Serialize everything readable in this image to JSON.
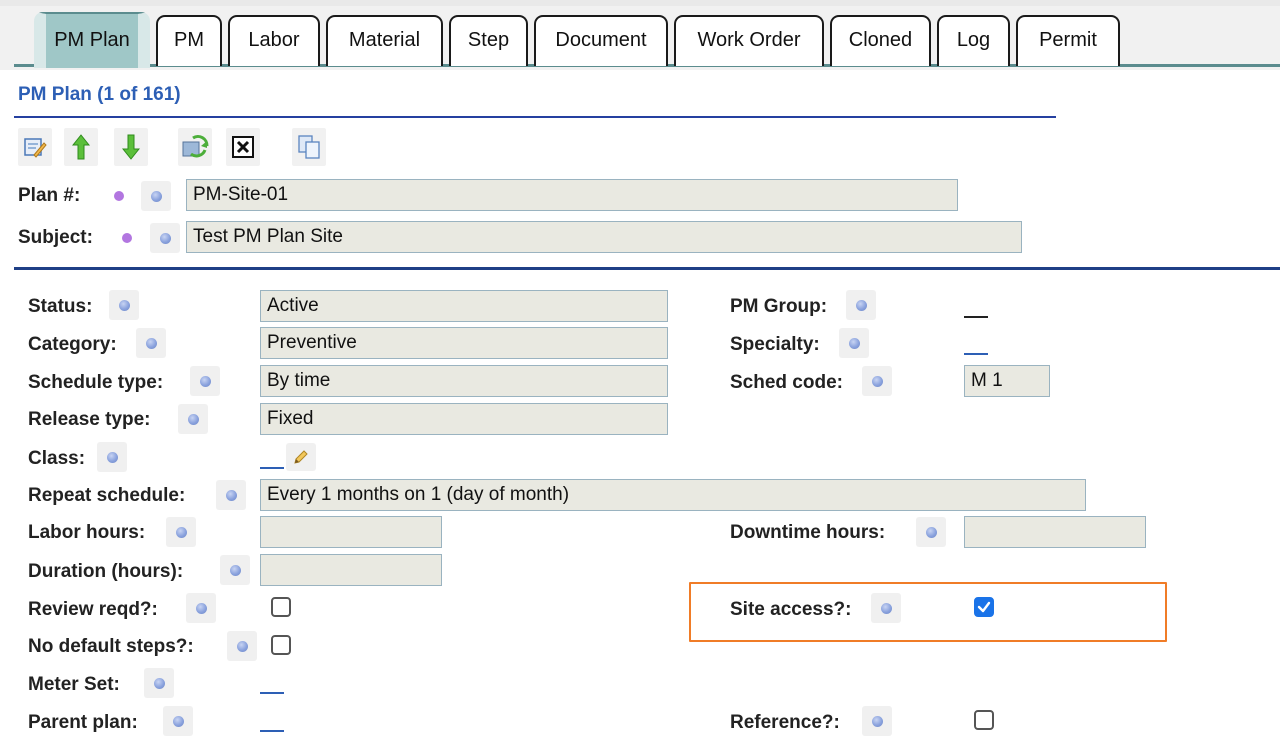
{
  "tabs": [
    {
      "label": "PM Plan",
      "active": true
    },
    {
      "label": "PM",
      "active": false
    },
    {
      "label": "Labor",
      "active": false
    },
    {
      "label": "Material",
      "active": false
    },
    {
      "label": "Step",
      "active": false
    },
    {
      "label": "Document",
      "active": false
    },
    {
      "label": "Work Order",
      "active": false
    },
    {
      "label": "Cloned",
      "active": false
    },
    {
      "label": "Log",
      "active": false
    },
    {
      "label": "Permit",
      "active": false
    }
  ],
  "header": {
    "title": "PM Plan (1 of 161)"
  },
  "toolbar": {
    "icons": [
      "edit-icon",
      "move-up-icon",
      "move-down-icon",
      "refresh-icon",
      "delete-icon",
      "copy-icon"
    ]
  },
  "top_fields": {
    "plan_number": {
      "label": "Plan #:",
      "value": "PM-Site-01"
    },
    "subject": {
      "label": "Subject:",
      "value": "Test PM Plan Site"
    }
  },
  "details": {
    "status": {
      "label": "Status:",
      "value": "Active"
    },
    "category": {
      "label": "Category:",
      "value": "Preventive"
    },
    "schedule_type": {
      "label": "Schedule type:",
      "value": "By time"
    },
    "release_type": {
      "label": "Release type:",
      "value": "Fixed"
    },
    "class": {
      "label": "Class:",
      "value": ""
    },
    "repeat_schedule": {
      "label": "Repeat schedule:",
      "value": "Every 1 months on 1 (day of month)"
    },
    "labor_hours": {
      "label": "Labor hours:",
      "value": ""
    },
    "duration_hours": {
      "label": "Duration (hours):",
      "value": ""
    },
    "review_reqd": {
      "label": "Review reqd?:",
      "checked": false
    },
    "no_default_steps": {
      "label": "No default steps?:",
      "checked": false
    },
    "meter_set": {
      "label": "Meter Set:",
      "value": ""
    },
    "parent_plan": {
      "label": "Parent plan:",
      "value": ""
    },
    "pm_group": {
      "label": "PM Group:",
      "value": ""
    },
    "specialty": {
      "label": "Specialty:",
      "value": ""
    },
    "sched_code": {
      "label": "Sched code:",
      "value": "M 1"
    },
    "downtime_hours": {
      "label": "Downtime hours:",
      "value": ""
    },
    "site_access": {
      "label": "Site access?:",
      "checked": true
    },
    "reference": {
      "label": "Reference?:",
      "checked": false
    }
  },
  "colors": {
    "tab_active": "#9fc7c7",
    "title_blue": "#2d5fb5",
    "highlight": "#f07c27",
    "checkbox_checked": "#1a73e8"
  }
}
